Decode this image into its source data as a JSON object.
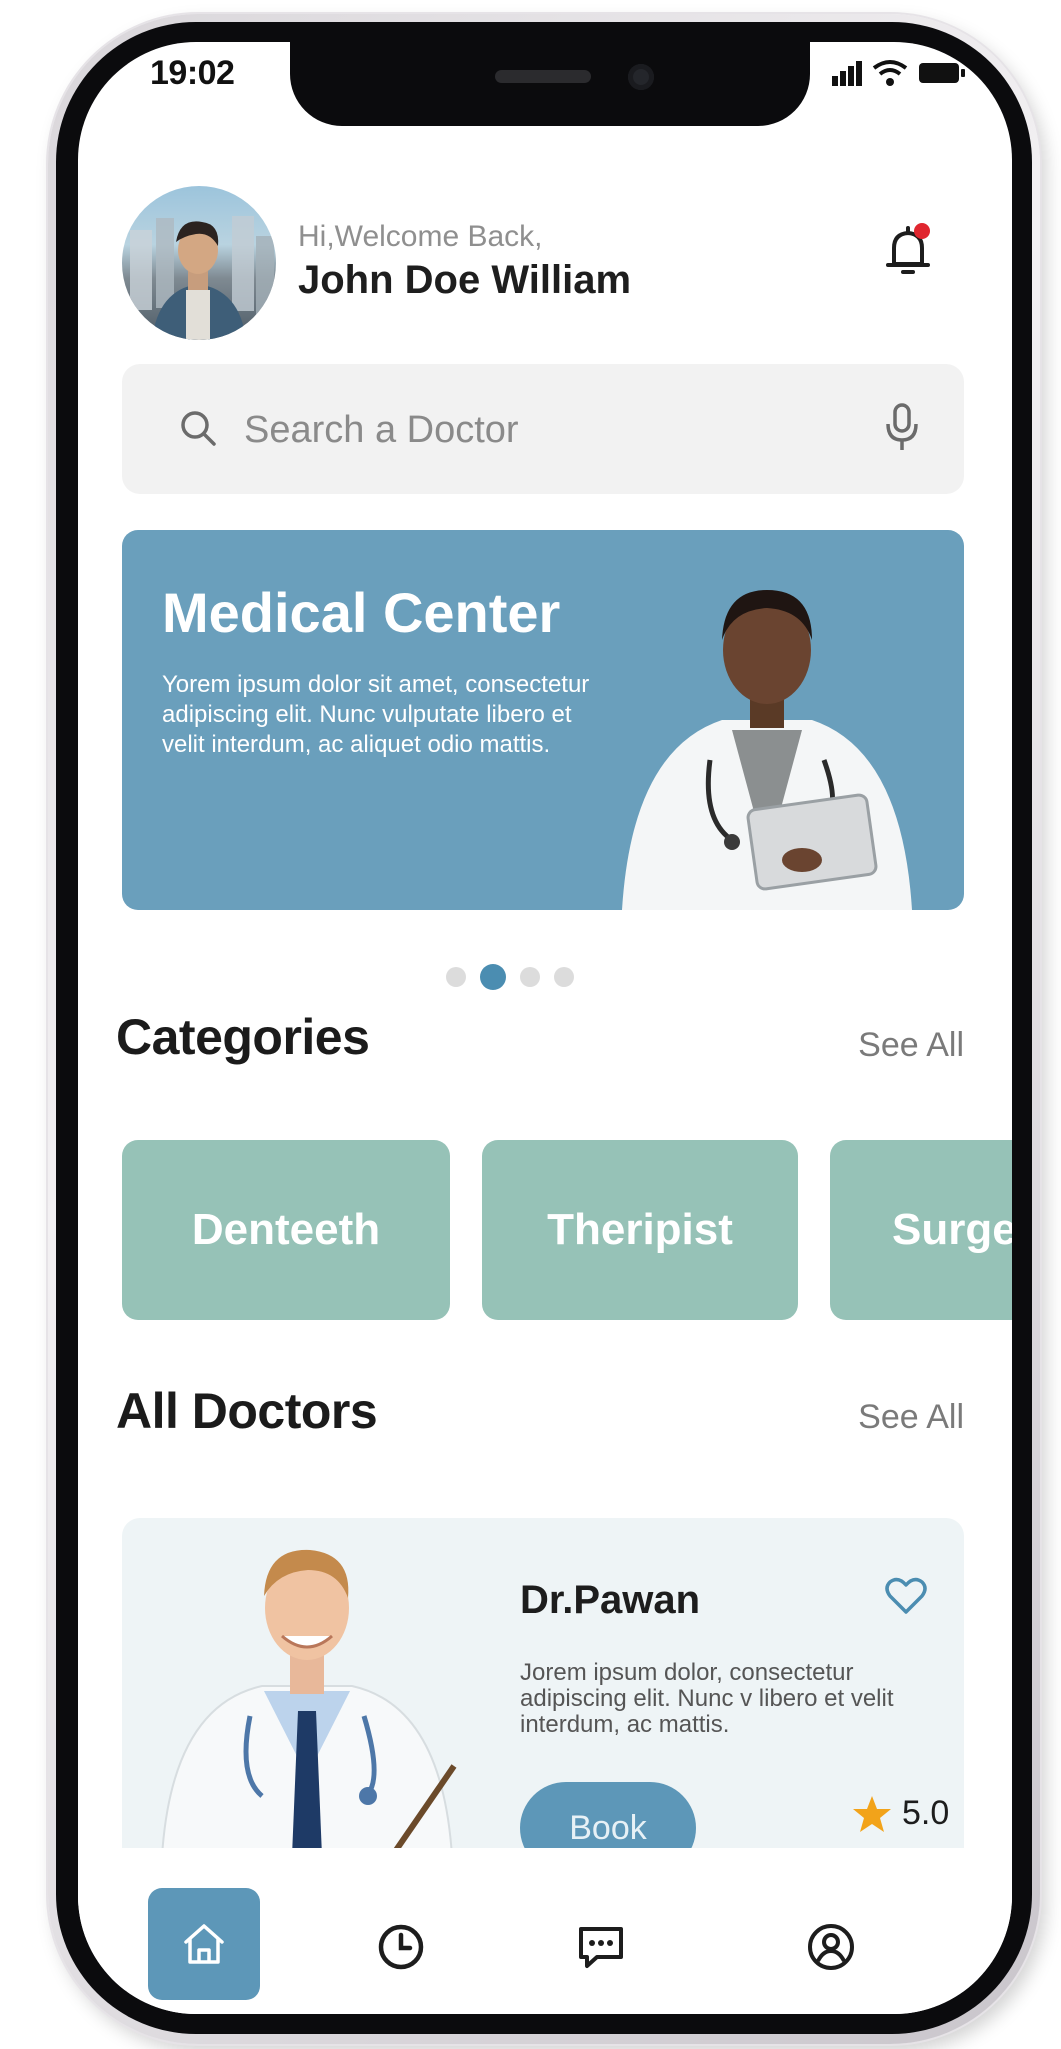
{
  "status_bar": {
    "time": "19:02"
  },
  "header": {
    "greeting": "Hi,Welcome Back,",
    "user_name": "John Doe William",
    "notification_dot_color": "#e0262f"
  },
  "search": {
    "placeholder": "Search a Doctor"
  },
  "banner": {
    "title": "Medical Center",
    "text": "Yorem ipsum dolor sit amet, consectetur adipiscing elit. Nunc vulputate libero et velit interdum, ac aliquet odio mattis.",
    "background_color": "#6a9fbc",
    "carousel": {
      "total": 4,
      "active_index": 1
    }
  },
  "categories": {
    "title": "Categories",
    "see_all": "See All",
    "items": [
      "Denteeth",
      "Theripist",
      "Surge"
    ]
  },
  "doctors": {
    "title": "All Doctors",
    "see_all": "See All",
    "items": [
      {
        "name": "Dr.Pawan",
        "description": "Jorem ipsum dolor, consectetur adipiscing elit. Nunc v libero et velit interdum, ac  mattis.",
        "book_label": "Book",
        "rating": "5.0"
      }
    ]
  },
  "bottom_nav": {
    "items": [
      "home-icon",
      "clock-icon",
      "chat-icon",
      "profile-icon"
    ],
    "active": "home-icon",
    "accent_color": "#5d97b8"
  }
}
